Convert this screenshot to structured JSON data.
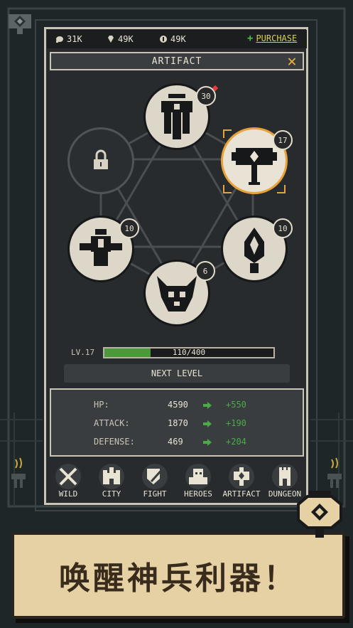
{
  "resources": {
    "food": {
      "icon": "meat-icon",
      "value": "31K"
    },
    "gems": {
      "icon": "gem-icon",
      "value": "49K"
    },
    "coins": {
      "icon": "coin-icon",
      "value": "49K"
    },
    "purchase_label": "PURCHASE"
  },
  "header": {
    "title": "ARTIFACT"
  },
  "artifacts": [
    {
      "name": "chalice-artifact",
      "level": "30",
      "alert": true
    },
    {
      "name": "locked-slot",
      "locked": true
    },
    {
      "name": "hammer-artifact",
      "level": "17",
      "selected": true
    },
    {
      "name": "scarab-artifact",
      "level": "10"
    },
    {
      "name": "flame-artifact",
      "level": "10"
    },
    {
      "name": "skull-artifact",
      "level": "6"
    }
  ],
  "level": {
    "label": "LV.17",
    "progress_text": "110/400",
    "current": 110,
    "max": 400
  },
  "next_level_label": "NEXT LEVEL",
  "stats": [
    {
      "name": "HP:",
      "value": "4590",
      "bonus": "+550"
    },
    {
      "name": "ATTACK:",
      "value": "1870",
      "bonus": "+190"
    },
    {
      "name": "DEFENSE:",
      "value": "469",
      "bonus": "+204"
    }
  ],
  "nav": [
    {
      "label": "WILD",
      "icon": "crossed-swords-icon"
    },
    {
      "label": "CITY",
      "icon": "castle-icon"
    },
    {
      "label": "FIGHT",
      "icon": "shield-sword-icon"
    },
    {
      "label": "HEROES",
      "icon": "hero-helmet-icon"
    },
    {
      "label": "ARTIFACT",
      "icon": "artifact-icon"
    },
    {
      "label": "DUNGEON",
      "icon": "tower-icon"
    }
  ],
  "banner_text": "唤醒神兵利器！",
  "colors": {
    "accent": "#e8a23a",
    "bonus": "#4caa4a",
    "panel": "#282b2d",
    "banner": "#e6d1a5"
  }
}
